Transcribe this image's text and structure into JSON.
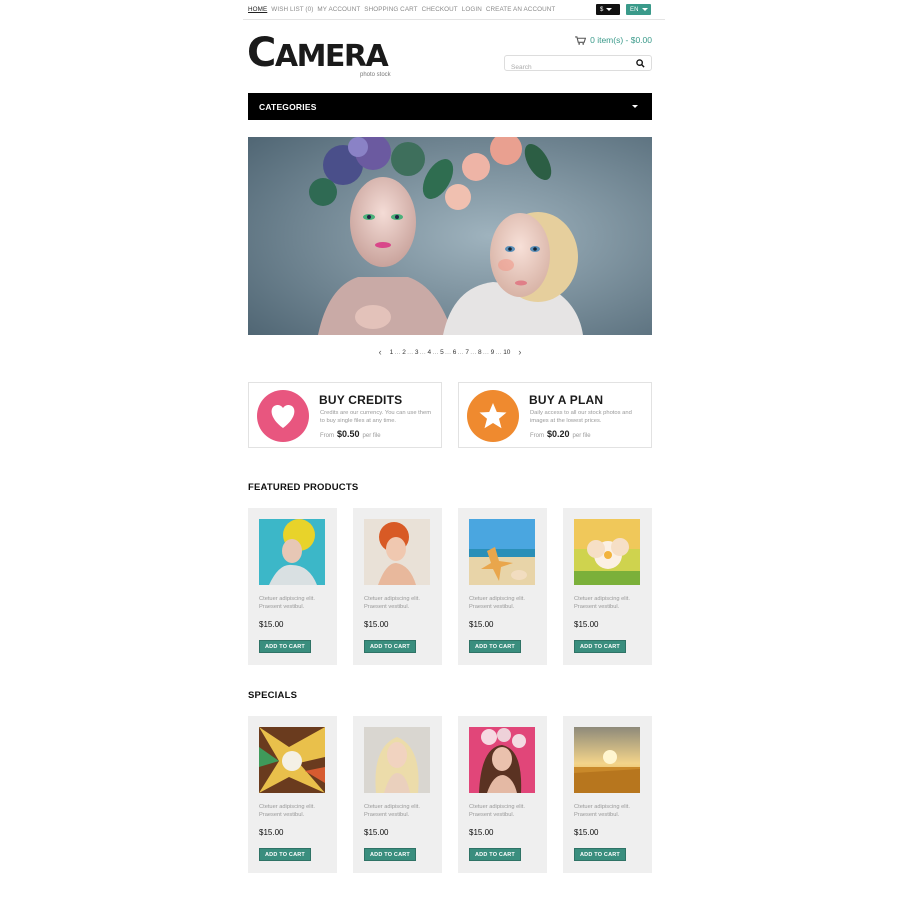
{
  "topnav": {
    "links": [
      "Home",
      "Wish List (0)",
      "My Account",
      "Shopping Cart",
      "Checkout",
      "Login",
      "Create an Account"
    ],
    "currency": "$",
    "language": "EN"
  },
  "logo": {
    "first": "C",
    "rest": "AMERA",
    "tagline": "photo stock"
  },
  "cart": {
    "summary": "0 item(s) - $0.00"
  },
  "search": {
    "placeholder": "Search"
  },
  "categories": {
    "label": "Categories"
  },
  "pager": {
    "pages": [
      "1",
      "2",
      "3",
      "4",
      "5",
      "6",
      "7",
      "8",
      "9",
      "10"
    ]
  },
  "promos": [
    {
      "title": "BUY CREDITS",
      "desc": "Credits are our currency. You can use them to buy single files at any time.",
      "from": "From",
      "price": "$0.50",
      "per": "per file",
      "color": "#e8567f",
      "icon": "heart-icon"
    },
    {
      "title": "BUY A PLAN",
      "desc": "Daily access to all our stock photos and images at the lowest prices.",
      "from": "From",
      "price": "$0.20",
      "per": "per file",
      "color": "#ef8a2f",
      "icon": "star-icon"
    }
  ],
  "featured": {
    "title": "Featured Products",
    "items": [
      {
        "desc": "Ctetuer adipiscing elit. Praesent vestibul.",
        "price": "$15.00",
        "button": "Add to Cart"
      },
      {
        "desc": "Ctetuer adipiscing elit. Praesent vestibul.",
        "price": "$15.00",
        "button": "Add to Cart"
      },
      {
        "desc": "Ctetuer adipiscing elit. Praesent vestibul.",
        "price": "$15.00",
        "button": "Add to Cart"
      },
      {
        "desc": "Ctetuer adipiscing elit. Praesent vestibul.",
        "price": "$15.00",
        "button": "Add to Cart"
      }
    ]
  },
  "specials": {
    "title": "Specials",
    "items": [
      {
        "desc": "Ctetuer adipiscing elit. Praesent vestibul.",
        "price": "$15.00",
        "button": "Add to Cart"
      },
      {
        "desc": "Ctetuer adipiscing elit. Praesent vestibul.",
        "price": "$15.00",
        "button": "Add to Cart"
      },
      {
        "desc": "Ctetuer adipiscing elit. Praesent vestibul.",
        "price": "$15.00",
        "button": "Add to Cart"
      },
      {
        "desc": "Ctetuer adipiscing elit. Praesent vestibul.",
        "price": "$15.00",
        "button": "Add to Cart"
      }
    ]
  },
  "colors": {
    "accent": "#3a9a8a",
    "button": "#3a8e7e",
    "dark": "#000000"
  }
}
